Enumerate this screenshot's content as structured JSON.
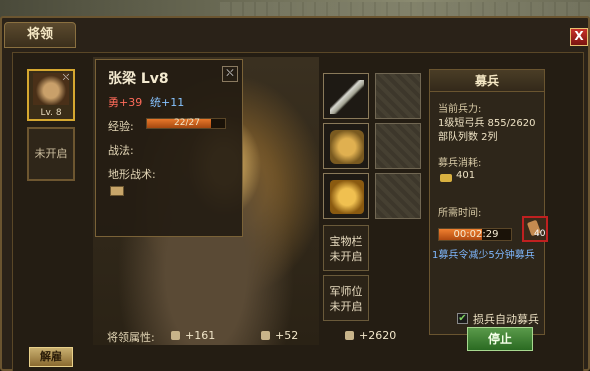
{
  "window": {
    "title": "将领",
    "close": "X"
  },
  "hero_slot": {
    "level": "Lv. 8"
  },
  "locked_slot": {
    "label": "未开启"
  },
  "general": {
    "name": "张梁 Lv8",
    "bravery": "勇+39",
    "command": "统+11",
    "exp_label": "经验:",
    "exp_value": "22/27",
    "exp_progress": 0.815,
    "tactics_label": "战法:",
    "terrain_label": "地形战术:"
  },
  "equipment": {
    "treasure_slot": "宝物栏\n未开启",
    "advisor_slot": "军师位\n未开启"
  },
  "attributes": {
    "label": "将领属性:",
    "attack": "+161",
    "defense": "+52",
    "troops": "+2620"
  },
  "dismiss_button": "解雇",
  "recruit": {
    "header": "募兵",
    "current_troops_label": "当前兵力:",
    "current_troops_value": "1级短弓兵 855/2620",
    "formation": "部队列数 2列",
    "cost_label": "募兵消耗:",
    "cost_value": "401",
    "time_label": "所需时间:",
    "time_value": "00:02:29",
    "time_progress": 0.6,
    "token_count": "40",
    "token_note": "1募兵令减少5分钟募兵",
    "auto_label": "损兵自动募兵",
    "auto_checked": true,
    "stop_button": "停止"
  }
}
